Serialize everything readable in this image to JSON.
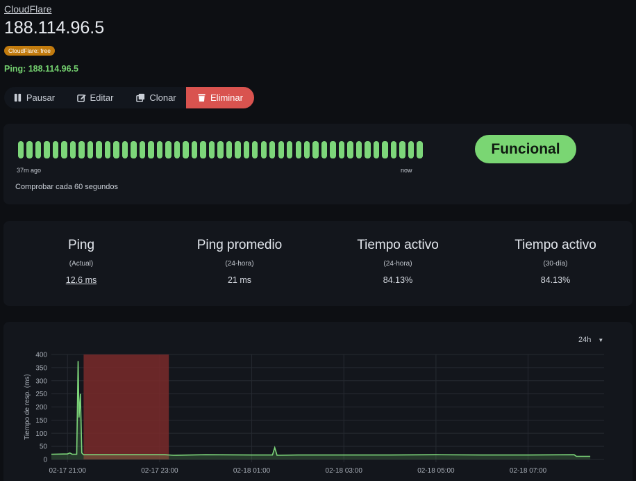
{
  "header": {
    "group": "CloudFlare",
    "title": "188.114.96.5",
    "tag": "CloudFlare: free",
    "ping": "Ping: 188.114.96.5"
  },
  "actions": {
    "pause": "Pausar",
    "edit": "Editar",
    "clone": "Clonar",
    "delete": "Eliminar",
    "delete_color": "#d9534f"
  },
  "heartbeat": {
    "count": 47,
    "beat_status": "up",
    "beat_color": "#7dd67a",
    "time_left": "37m ago",
    "time_right": "now",
    "interval": "Comprobar cada 60 segundos",
    "status": "Funcional",
    "status_color": "#7ad673"
  },
  "stats": [
    {
      "title": "Ping",
      "sub": "(Actual)",
      "value": "12.6 ms"
    },
    {
      "title": "Ping promedio",
      "sub": "(24-hora)",
      "value": "21 ms"
    },
    {
      "title": "Tiempo activo",
      "sub": "(24-hora)",
      "value": "84.13%"
    },
    {
      "title": "Tiempo activo",
      "sub": "(30-día)",
      "value": "84.13%"
    }
  ],
  "chart": {
    "range": "24h"
  },
  "chart_data": {
    "type": "line",
    "ylabel": "Tiempo de resp. (ms)",
    "ylim": [
      0,
      400
    ],
    "yticks": [
      0,
      50,
      100,
      150,
      200,
      250,
      300,
      350,
      400
    ],
    "xlabels": [
      "02-17 21:00",
      "02-17 23:00",
      "02-18 01:00",
      "02-18 03:00",
      "02-18 05:00",
      "02-18 07:00"
    ],
    "xlabel_hours": [
      0,
      2,
      4,
      6,
      8,
      10
    ],
    "xlim_hours": [
      -0.35,
      11.65
    ],
    "grid": true,
    "series": [
      {
        "color": "#7dd67a",
        "points": [
          [
            -0.35,
            20
          ],
          [
            0,
            21
          ],
          [
            0.05,
            25
          ],
          [
            0.1,
            20
          ],
          [
            0.2,
            20
          ],
          [
            0.23,
            375
          ],
          [
            0.25,
            160
          ],
          [
            0.28,
            250
          ],
          [
            0.31,
            25
          ],
          [
            0.35,
            18
          ],
          [
            2.12,
            18
          ],
          [
            2.3,
            16
          ],
          [
            3,
            18
          ],
          [
            4,
            17
          ],
          [
            4.45,
            17
          ],
          [
            4.5,
            45
          ],
          [
            4.55,
            16
          ],
          [
            5,
            17
          ],
          [
            6,
            17
          ],
          [
            7,
            17
          ],
          [
            8,
            18
          ],
          [
            9,
            17
          ],
          [
            10,
            17
          ],
          [
            11,
            18
          ],
          [
            11.05,
            12
          ],
          [
            11.35,
            12
          ]
        ]
      }
    ],
    "downtime": [
      [
        0.35,
        2.2
      ]
    ],
    "downtime_color": "#7a2a2a"
  }
}
